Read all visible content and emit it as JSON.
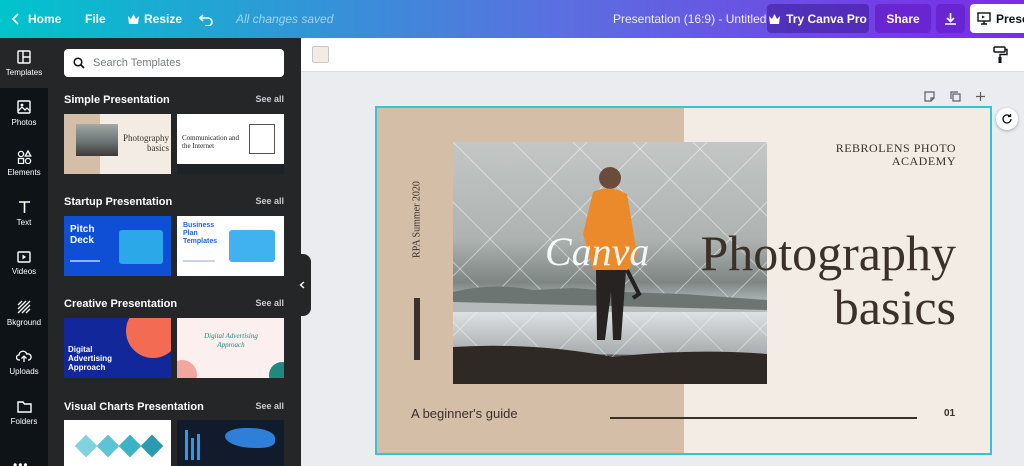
{
  "topbar": {
    "home": "Home",
    "file": "File",
    "resize": "Resize",
    "saved_status": "All changes saved",
    "doc_title": "Presentation (16:9) - Untitled",
    "try_pro": "Try Canva Pro",
    "share": "Share",
    "present": "Prese"
  },
  "rail": [
    {
      "label": "Templates"
    },
    {
      "label": "Photos"
    },
    {
      "label": "Elements"
    },
    {
      "label": "Text"
    },
    {
      "label": "Videos"
    },
    {
      "label": "Bkground"
    },
    {
      "label": "Uploads"
    },
    {
      "label": "Folders"
    }
  ],
  "panel": {
    "search_placeholder": "Search Templates",
    "see_all": "See all",
    "sections": [
      {
        "title": "Simple Presentation"
      },
      {
        "title": "Startup Presentation"
      },
      {
        "title": "Creative Presentation"
      },
      {
        "title": "Visual Charts Presentation"
      }
    ],
    "thumbs": {
      "photo_title": "Photography basics",
      "comm_title": "Communication and the Internet",
      "pitch_title": "Pitch Deck",
      "business_title": "Business Plan Templates",
      "digital_title": "Digital Advertising Approach",
      "script_title": "Digital Advertising Approach"
    }
  },
  "colors": {
    "accent": "#2fc7d6",
    "purple": "#7d2ae8",
    "share": "#7d2ae8",
    "slide_tan": "#d4bea7",
    "slide_cream": "#f2ece4",
    "text_dark": "#3b302a"
  },
  "slide": {
    "vertical_text": "RPA Summer 2020",
    "academy": "REBROLENS PHOTO ACADEMY",
    "watermark": "Canva",
    "title_line1": "Photography",
    "title_line2": "basics",
    "subtitle": "A beginner's guide",
    "page_number": "01"
  }
}
